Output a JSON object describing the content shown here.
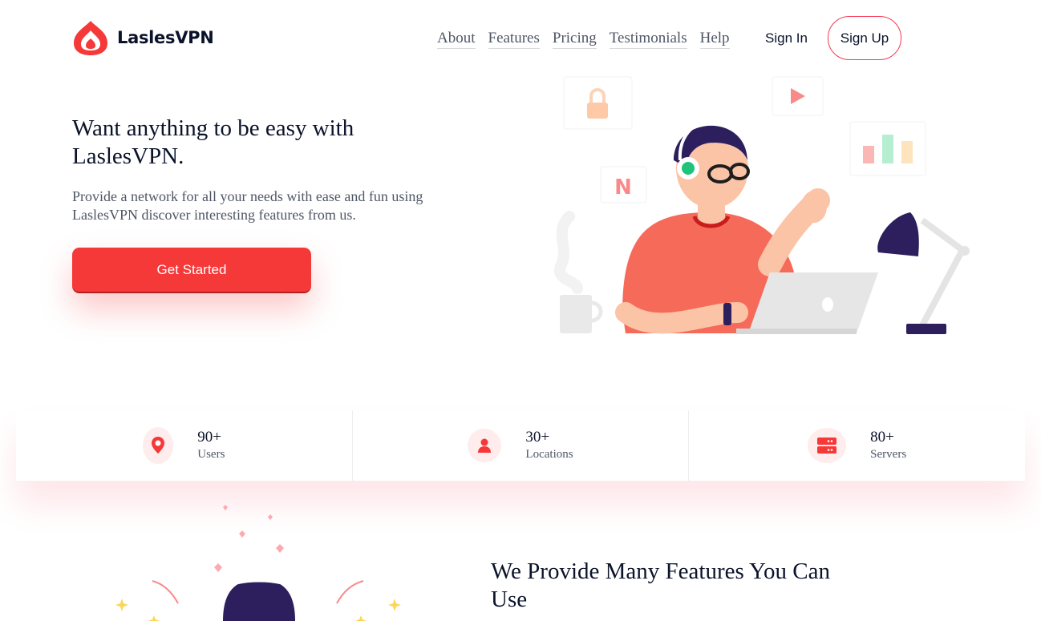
{
  "brand": {
    "name": "LaslesVPN",
    "accent": "#f53838"
  },
  "nav": {
    "items": [
      "About",
      "Features",
      "Pricing",
      "Testimonials",
      "Help"
    ],
    "sign_in": "Sign In",
    "sign_up": "Sign Up"
  },
  "hero": {
    "title": "Want anything to be easy with LaslesVPN.",
    "description": "Provide a network for all your needs with ease and fun using LaslesVPN discover interesting features from us.",
    "cta": "Get Started"
  },
  "stats": [
    {
      "value": "90+",
      "label": "Users",
      "icon": "user-icon"
    },
    {
      "value": "30+",
      "label": "Locations",
      "icon": "location-icon"
    },
    {
      "value": "80+",
      "label": "Servers",
      "icon": "server-icon"
    }
  ],
  "features": {
    "title": "We Provide Many Features You Can Use"
  }
}
